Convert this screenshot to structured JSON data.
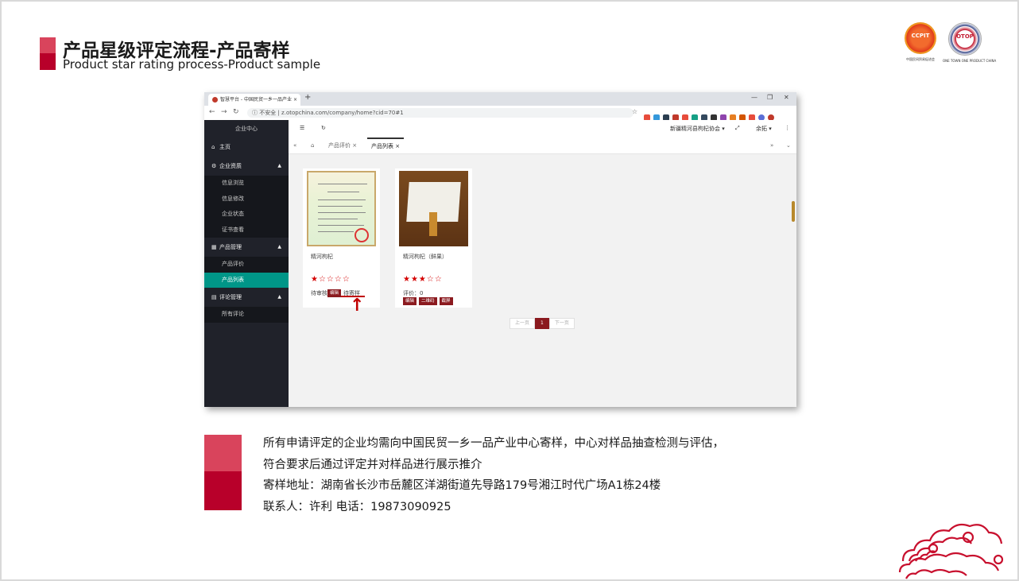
{
  "slide": {
    "title": "产品星级评定流程-产品寄样",
    "subtitle": "Product star rating process-Product sample",
    "logo_left": {
      "text": "CCPIT",
      "caption": "中国民间贸易促进会"
    },
    "logo_right": {
      "text": "OTOP",
      "caption": "ONE TOWN ONE PRODUCT CHINA"
    },
    "notes": [
      "所有申请评定的企业均需向中国民贸一乡一品产业中心寄样，中心对样品抽查检测与评估，",
      "符合要求后通过评定并对样品进行展示推介",
      "寄样地址：湖南省长沙市岳麓区洋湖街道先导路179号湘江时代广场A1栋24楼",
      "联系人：许利   电话：19873090925"
    ]
  },
  "browser": {
    "tab_title": "智慧平台 - 中国民贸一乡一品产业",
    "tab_close": "×",
    "new_tab": "+",
    "url_prefix": "不安全",
    "url": "z.otopchina.com/company/home?cid=70#1"
  },
  "sidebar": {
    "header": "企业中心",
    "home": "主页",
    "sections": [
      {
        "label": "企业资质",
        "items": [
          "信息浏览",
          "信息修改",
          "企业状态",
          "证书查看"
        ]
      },
      {
        "label": "产品管理",
        "items": [
          "产品评价",
          "产品列表"
        ]
      },
      {
        "label": "评论管理",
        "items": [
          "所有评论"
        ]
      }
    ],
    "active_item": "产品列表"
  },
  "toolbar": {
    "company": "新疆精河县枸杞协会",
    "user": "余拓"
  },
  "page_tabs": [
    "产品评价",
    "产品列表"
  ],
  "products": [
    {
      "name": "精河枸杞",
      "rating": 1,
      "stars": "★☆☆☆☆",
      "status": "待审核",
      "buttons": [
        "编辑"
      ],
      "extra": "待寄样"
    },
    {
      "name": "精河枸杞（鲜果）",
      "rating": 3,
      "stars": "★★★☆☆",
      "status": "评价：0",
      "buttons": [
        "编辑",
        "二维码",
        "截屏"
      ],
      "extra": ""
    }
  ],
  "pagination": {
    "prev": "上一页",
    "current": "1",
    "next": "下一页"
  },
  "colors": {
    "accent_light": "#d9445c",
    "accent_dark": "#b8002a",
    "sidebar_active": "#009688",
    "button": "#8b1a1f"
  }
}
